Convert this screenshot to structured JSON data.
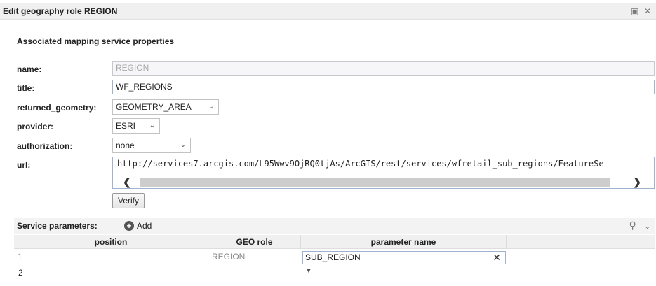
{
  "dialog": {
    "title": "Edit geography role REGION",
    "section_title": "Associated mapping service properties"
  },
  "icons": {
    "restore": "restore-icon",
    "close": "close-icon",
    "search": "search-icon",
    "add": "add-circle-icon"
  },
  "form": {
    "name": {
      "label": "name:",
      "value": "REGION"
    },
    "title": {
      "label": "title:",
      "value": "WF_REGIONS"
    },
    "returned_geometry": {
      "label": "returned_geometry:",
      "value": "GEOMETRY_AREA"
    },
    "provider": {
      "label": "provider:",
      "value": "ESRI"
    },
    "authorization": {
      "label": "authorization:",
      "value": "none"
    },
    "url": {
      "label": "url:",
      "value": "http://services7.arcgis.com/L95Wwv9OjRQ0tjAs/ArcGIS/rest/services/wfretail_sub_regions/FeatureSe"
    },
    "verify_label": "Verify"
  },
  "service_parameters": {
    "label": "Service parameters:",
    "add_label": "Add",
    "columns": [
      "position",
      "GEO role",
      "parameter name"
    ],
    "rows": [
      {
        "position": "1",
        "geo_role": "REGION",
        "parameter_name": "SUB_REGION"
      },
      {
        "position": "2",
        "geo_role": "",
        "parameter_name": ""
      }
    ]
  },
  "colors": {
    "field_border": "#9fb4cc",
    "disabled_text": "#a8a8a8"
  }
}
